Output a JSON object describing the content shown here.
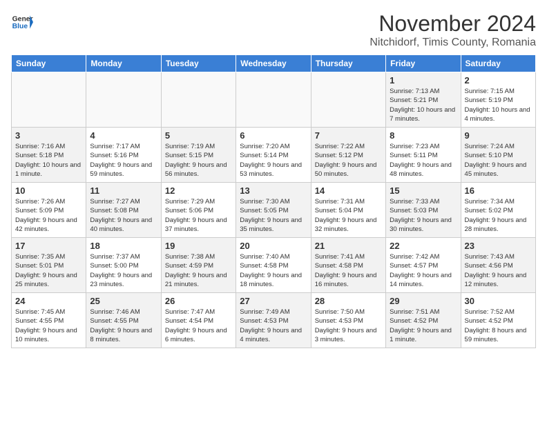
{
  "header": {
    "logo_general": "General",
    "logo_blue": "Blue",
    "month_title": "November 2024",
    "location": "Nitchidorf, Timis County, Romania"
  },
  "days_of_week": [
    "Sunday",
    "Monday",
    "Tuesday",
    "Wednesday",
    "Thursday",
    "Friday",
    "Saturday"
  ],
  "weeks": [
    [
      {
        "day": "",
        "info": ""
      },
      {
        "day": "",
        "info": ""
      },
      {
        "day": "",
        "info": ""
      },
      {
        "day": "",
        "info": ""
      },
      {
        "day": "",
        "info": ""
      },
      {
        "day": "1",
        "info": "Sunrise: 7:13 AM\nSunset: 5:21 PM\nDaylight: 10 hours and 7 minutes."
      },
      {
        "day": "2",
        "info": "Sunrise: 7:15 AM\nSunset: 5:19 PM\nDaylight: 10 hours and 4 minutes."
      }
    ],
    [
      {
        "day": "3",
        "info": "Sunrise: 7:16 AM\nSunset: 5:18 PM\nDaylight: 10 hours and 1 minute."
      },
      {
        "day": "4",
        "info": "Sunrise: 7:17 AM\nSunset: 5:16 PM\nDaylight: 9 hours and 59 minutes."
      },
      {
        "day": "5",
        "info": "Sunrise: 7:19 AM\nSunset: 5:15 PM\nDaylight: 9 hours and 56 minutes."
      },
      {
        "day": "6",
        "info": "Sunrise: 7:20 AM\nSunset: 5:14 PM\nDaylight: 9 hours and 53 minutes."
      },
      {
        "day": "7",
        "info": "Sunrise: 7:22 AM\nSunset: 5:12 PM\nDaylight: 9 hours and 50 minutes."
      },
      {
        "day": "8",
        "info": "Sunrise: 7:23 AM\nSunset: 5:11 PM\nDaylight: 9 hours and 48 minutes."
      },
      {
        "day": "9",
        "info": "Sunrise: 7:24 AM\nSunset: 5:10 PM\nDaylight: 9 hours and 45 minutes."
      }
    ],
    [
      {
        "day": "10",
        "info": "Sunrise: 7:26 AM\nSunset: 5:09 PM\nDaylight: 9 hours and 42 minutes."
      },
      {
        "day": "11",
        "info": "Sunrise: 7:27 AM\nSunset: 5:08 PM\nDaylight: 9 hours and 40 minutes."
      },
      {
        "day": "12",
        "info": "Sunrise: 7:29 AM\nSunset: 5:06 PM\nDaylight: 9 hours and 37 minutes."
      },
      {
        "day": "13",
        "info": "Sunrise: 7:30 AM\nSunset: 5:05 PM\nDaylight: 9 hours and 35 minutes."
      },
      {
        "day": "14",
        "info": "Sunrise: 7:31 AM\nSunset: 5:04 PM\nDaylight: 9 hours and 32 minutes."
      },
      {
        "day": "15",
        "info": "Sunrise: 7:33 AM\nSunset: 5:03 PM\nDaylight: 9 hours and 30 minutes."
      },
      {
        "day": "16",
        "info": "Sunrise: 7:34 AM\nSunset: 5:02 PM\nDaylight: 9 hours and 28 minutes."
      }
    ],
    [
      {
        "day": "17",
        "info": "Sunrise: 7:35 AM\nSunset: 5:01 PM\nDaylight: 9 hours and 25 minutes."
      },
      {
        "day": "18",
        "info": "Sunrise: 7:37 AM\nSunset: 5:00 PM\nDaylight: 9 hours and 23 minutes."
      },
      {
        "day": "19",
        "info": "Sunrise: 7:38 AM\nSunset: 4:59 PM\nDaylight: 9 hours and 21 minutes."
      },
      {
        "day": "20",
        "info": "Sunrise: 7:40 AM\nSunset: 4:58 PM\nDaylight: 9 hours and 18 minutes."
      },
      {
        "day": "21",
        "info": "Sunrise: 7:41 AM\nSunset: 4:58 PM\nDaylight: 9 hours and 16 minutes."
      },
      {
        "day": "22",
        "info": "Sunrise: 7:42 AM\nSunset: 4:57 PM\nDaylight: 9 hours and 14 minutes."
      },
      {
        "day": "23",
        "info": "Sunrise: 7:43 AM\nSunset: 4:56 PM\nDaylight: 9 hours and 12 minutes."
      }
    ],
    [
      {
        "day": "24",
        "info": "Sunrise: 7:45 AM\nSunset: 4:55 PM\nDaylight: 9 hours and 10 minutes."
      },
      {
        "day": "25",
        "info": "Sunrise: 7:46 AM\nSunset: 4:55 PM\nDaylight: 9 hours and 8 minutes."
      },
      {
        "day": "26",
        "info": "Sunrise: 7:47 AM\nSunset: 4:54 PM\nDaylight: 9 hours and 6 minutes."
      },
      {
        "day": "27",
        "info": "Sunrise: 7:49 AM\nSunset: 4:53 PM\nDaylight: 9 hours and 4 minutes."
      },
      {
        "day": "28",
        "info": "Sunrise: 7:50 AM\nSunset: 4:53 PM\nDaylight: 9 hours and 3 minutes."
      },
      {
        "day": "29",
        "info": "Sunrise: 7:51 AM\nSunset: 4:52 PM\nDaylight: 9 hours and 1 minute."
      },
      {
        "day": "30",
        "info": "Sunrise: 7:52 AM\nSunset: 4:52 PM\nDaylight: 8 hours and 59 minutes."
      }
    ]
  ]
}
